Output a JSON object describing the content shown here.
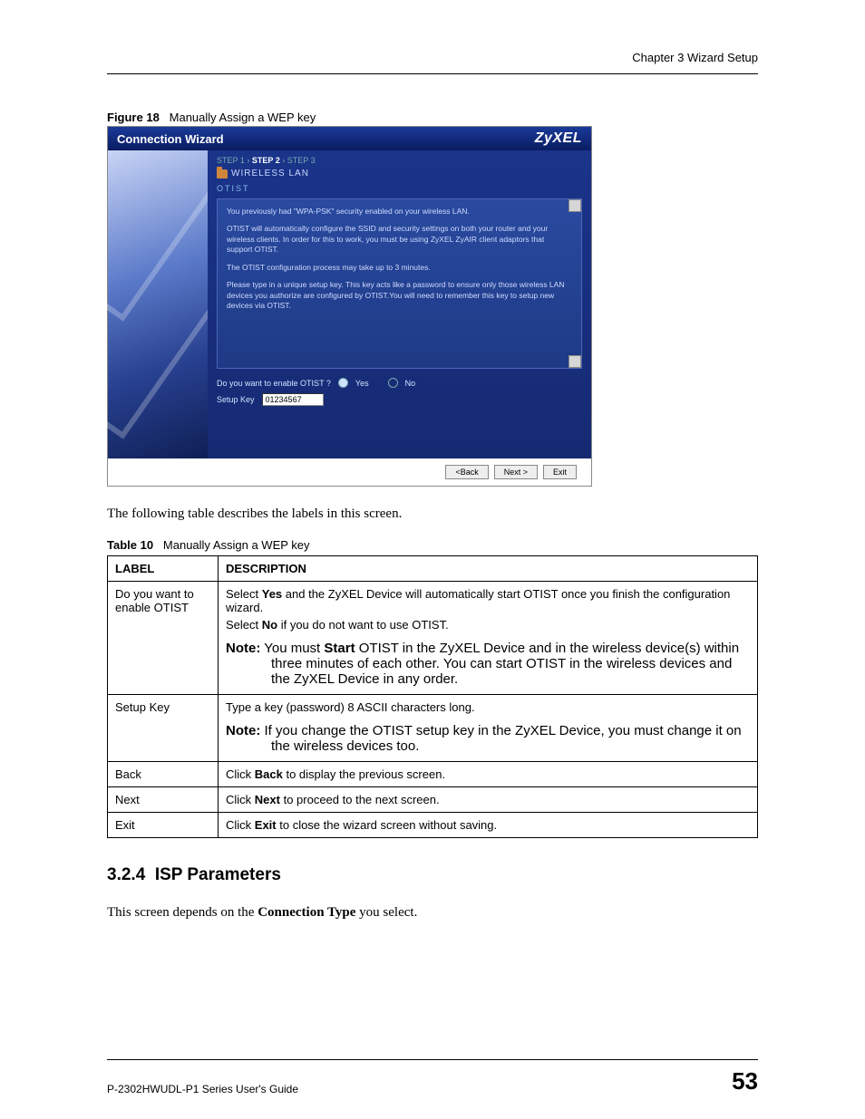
{
  "header": {
    "chapter": "Chapter 3 Wizard Setup"
  },
  "figure": {
    "num": "Figure 18",
    "title": "Manually Assign a WEP key"
  },
  "wizard": {
    "title": "Connection Wizard",
    "brand": "ZyXEL",
    "step1": "STEP 1",
    "step2": "STEP 2",
    "step3": "STEP 3",
    "arrow": "›",
    "section_label": "WIRELESS LAN",
    "sub_label": "OTIST",
    "p1": "You previously had \"WPA-PSK\" security enabled on your wireless LAN.",
    "p2": "OTIST will automatically configure the SSID and security settings on both your router and your wireless clients. In order for this to work, you must be using ZyXEL ZyAIR client adaptors that support OTIST.",
    "p3": "The OTIST configuration process may take up to 3 minutes.",
    "p4": "Please type in a unique setup key. This key acts like a password to ensure only those wireless LAN devices you authorize are configured by OTIST.You will need to remember this key to setup new devices via OTIST.",
    "question": "Do you want to enable OTIST ?",
    "opt_yes": "Yes",
    "opt_no": "No",
    "key_label": "Setup Key",
    "key_value": "01234567",
    "btn_back": "<Back",
    "btn_next": "Next >",
    "btn_exit": "Exit"
  },
  "para1": "The following table describes the labels in this screen.",
  "table": {
    "num": "Table 10",
    "title": "Manually Assign a WEP key",
    "h_label": "LABEL",
    "h_desc": "DESCRIPTION",
    "rows": {
      "r1": {
        "label": "Do you want to enable OTIST",
        "d1a": "Select ",
        "d1b": "Yes",
        "d1c": " and the ZyXEL Device will automatically start OTIST once you finish the configuration wizard.",
        "d2a": "Select ",
        "d2b": "No",
        "d2c": " if you do not want to use OTIST.",
        "note_pre": "Note:",
        "note_mid1": " You must ",
        "note_b": "Start",
        "note_mid2": " OTIST in the ZyXEL Device and in the wireless device(s) within three minutes of each other. You can start OTIST in the wireless devices and the ZyXEL Device in any order."
      },
      "r2": {
        "label": "Setup Key",
        "d1": "Type a key (password) 8 ASCII characters long.",
        "note_pre": "Note:",
        "note_txt": " If you change the OTIST setup key in the ZyXEL Device, you must change it on the wireless devices too."
      },
      "r3": {
        "label": "Back",
        "d_pre": "Click ",
        "d_b": "Back",
        "d_post": " to display the previous screen."
      },
      "r4": {
        "label": "Next",
        "d_pre": "Click ",
        "d_b": "Next",
        "d_post": " to proceed to the next screen."
      },
      "r5": {
        "label": "Exit",
        "d_pre": "Click ",
        "d_b": "Exit",
        "d_post": " to close the wizard screen without saving."
      }
    }
  },
  "section": {
    "num": "3.2.4",
    "title": "ISP Parameters",
    "body_pre": "This screen depends on the ",
    "body_b": "Connection Type",
    "body_post": " you select."
  },
  "footer": {
    "guide": "P-2302HWUDL-P1 Series User's Guide",
    "page": "53"
  }
}
